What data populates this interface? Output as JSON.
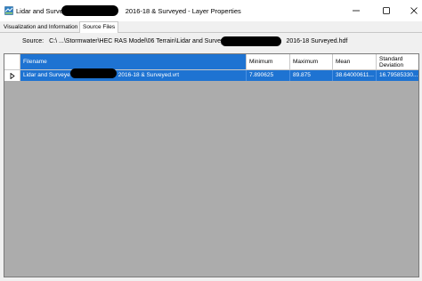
{
  "window": {
    "title_prefix": "Lidar and Survey",
    "title_suffix": "2016-18 & Surveyed - Layer Properties",
    "controls": {
      "minimize": "—",
      "maximize": "☐",
      "close": "✕"
    }
  },
  "tabs": [
    {
      "label": "Visualization and Information"
    },
    {
      "label": "Source Files"
    }
  ],
  "source": {
    "label": "Source:",
    "path_prefix": "C:\\ ...\\Stormwater\\HEC RAS Model\\06 Terrain\\Lidar and Survey",
    "path_suffix": "2016-18  Surveyed.hdf"
  },
  "table": {
    "columns": [
      "Filename",
      "Minimum",
      "Maximum",
      "Mean",
      "Standard Deviation"
    ],
    "rows": [
      {
        "filename_prefix": "Lidar and Surveye",
        "filename_suffix": "r 2016-18 & Surveyed.vrt",
        "minimum": "7.890625",
        "maximum": "89.875",
        "mean": "38.64000611...",
        "std": "16.79585330..."
      }
    ]
  },
  "colors": {
    "selection": "#1e73d2",
    "grid_background": "#acacac",
    "tab_background": "#f0f0f0"
  }
}
